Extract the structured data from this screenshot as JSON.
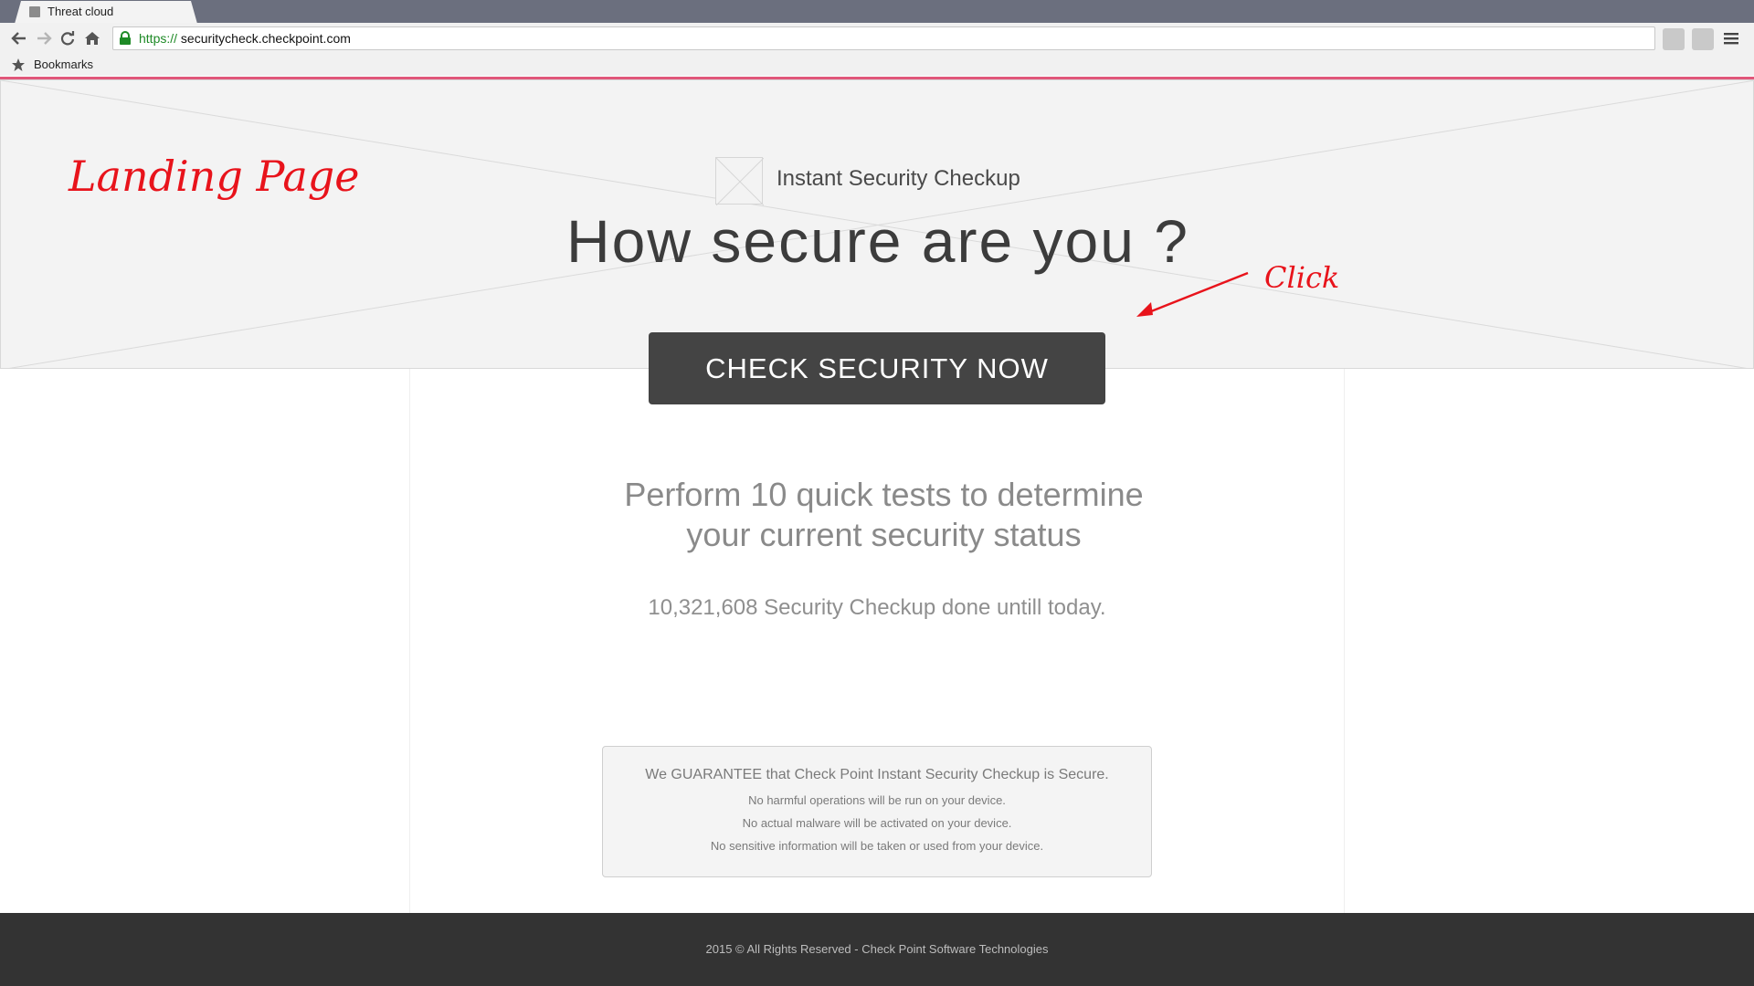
{
  "browser": {
    "tab_title": "Threat cloud",
    "url_scheme": "https://",
    "url_host": "securitycheck.checkpoint.com",
    "bookmarks_label": "Bookmarks",
    "accent_color": "#e0577a"
  },
  "annotations": {
    "landing": "Landing Page",
    "click": "Click",
    "color": "#e8131b"
  },
  "hero": {
    "subtitle": "Instant Security Checkup",
    "headline": "How secure are you ?",
    "cta_label": "CHECK SECURITY NOW"
  },
  "content": {
    "tests_line1": "Perform 10 quick tests to determine",
    "tests_line2": "your current security status",
    "count_text": "10,321,608 Security Checkup done untill today."
  },
  "guarantee": {
    "title": "We GUARANTEE that Check Point Instant Security Checkup is Secure.",
    "lines": [
      "No harmful operations will be run on your device.",
      "No actual malware will be activated on your device.",
      "No sensitive information will be taken or used from your device."
    ]
  },
  "footer": {
    "text": "2015 © All Rights Reserved - Check Point Software Technologies"
  }
}
